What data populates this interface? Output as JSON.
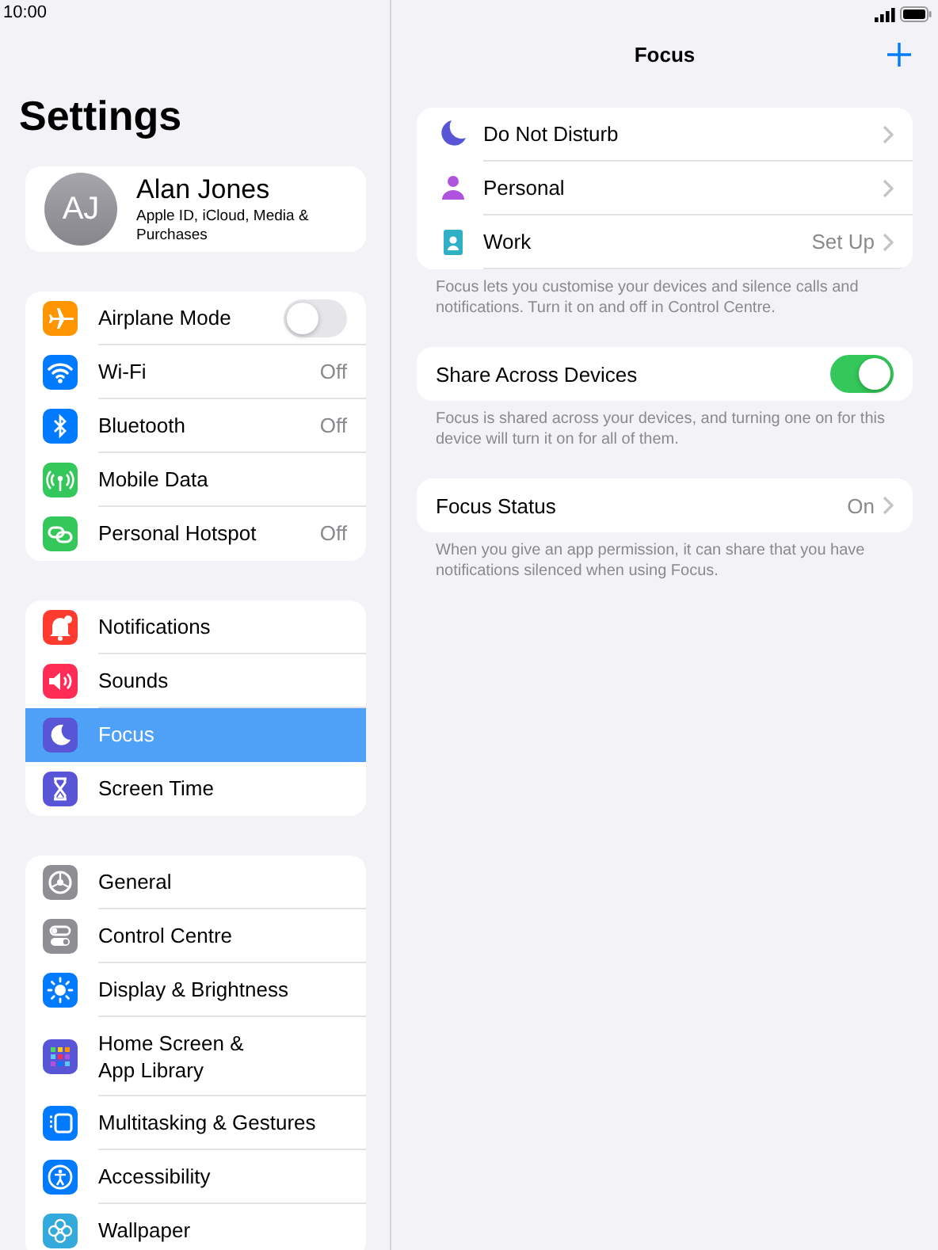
{
  "status_bar": {
    "time": "10:00"
  },
  "sidebar": {
    "title": "Settings",
    "profile": {
      "initials": "AJ",
      "name": "Alan Jones",
      "subtitle": "Apple ID, iCloud, Media & Purchases"
    },
    "groups": [
      {
        "items": [
          {
            "color": "#ff9500",
            "label": "Airplane Mode",
            "kind": "toggle",
            "on": false,
            "selected": false
          },
          {
            "color": "#007aff",
            "label": "Wi-Fi",
            "kind": "value",
            "value": "Off",
            "selected": false
          },
          {
            "color": "#007aff",
            "label": "Bluetooth",
            "kind": "value",
            "value": "Off",
            "selected": false
          },
          {
            "color": "#34c759",
            "label": "Mobile Data",
            "kind": "plain",
            "selected": false
          },
          {
            "color": "#34c759",
            "label": "Personal Hotspot",
            "kind": "value",
            "value": "Off",
            "selected": false
          }
        ]
      },
      {
        "items": [
          {
            "color": "#ff3b30",
            "label": "Notifications",
            "kind": "plain",
            "selected": false
          },
          {
            "color": "#ff2d55",
            "label": "Sounds",
            "kind": "plain",
            "selected": false
          },
          {
            "color": "#5856d6",
            "label": "Focus",
            "kind": "plain",
            "selected": true
          },
          {
            "color": "#5856d6",
            "label": "Screen Time",
            "kind": "plain",
            "selected": false
          }
        ]
      },
      {
        "items": [
          {
            "color": "#8e8e93",
            "label": "General",
            "kind": "plain",
            "selected": false
          },
          {
            "color": "#8e8e93",
            "label": "Control Centre",
            "kind": "plain",
            "selected": false
          },
          {
            "color": "#007aff",
            "label": "Display & Brightness",
            "kind": "plain",
            "selected": false
          },
          {
            "color": "#5856d6",
            "label": "Home Screen & App Library",
            "kind": "plain",
            "selected": false
          },
          {
            "color": "#007aff",
            "label": "Multitasking & Gestures",
            "kind": "plain",
            "selected": false
          },
          {
            "color": "#007aff",
            "label": "Accessibility",
            "kind": "plain",
            "selected": false
          },
          {
            "color": "#34aadc",
            "label": "Wallpaper",
            "kind": "plain",
            "selected": false
          }
        ]
      }
    ]
  },
  "detail": {
    "title": "Focus",
    "focus_modes": [
      {
        "color": "#5856d6",
        "label": "Do Not Disturb"
      },
      {
        "color": "#af52de",
        "label": "Personal"
      },
      {
        "color": "#30b0c7",
        "label": "Work",
        "value": "Set Up"
      }
    ],
    "focus_footer": "Focus lets you customise your devices and silence calls and notifications. Turn it on and off in Control Centre.",
    "share": {
      "label": "Share Across Devices",
      "on": true
    },
    "share_footer": "Focus is shared across your devices, and turning one on for this device will turn it on for all of them.",
    "status": {
      "label": "Focus Status",
      "value": "On"
    },
    "status_footer": "When you give an app permission, it can share that you have notifications silenced when using Focus."
  }
}
